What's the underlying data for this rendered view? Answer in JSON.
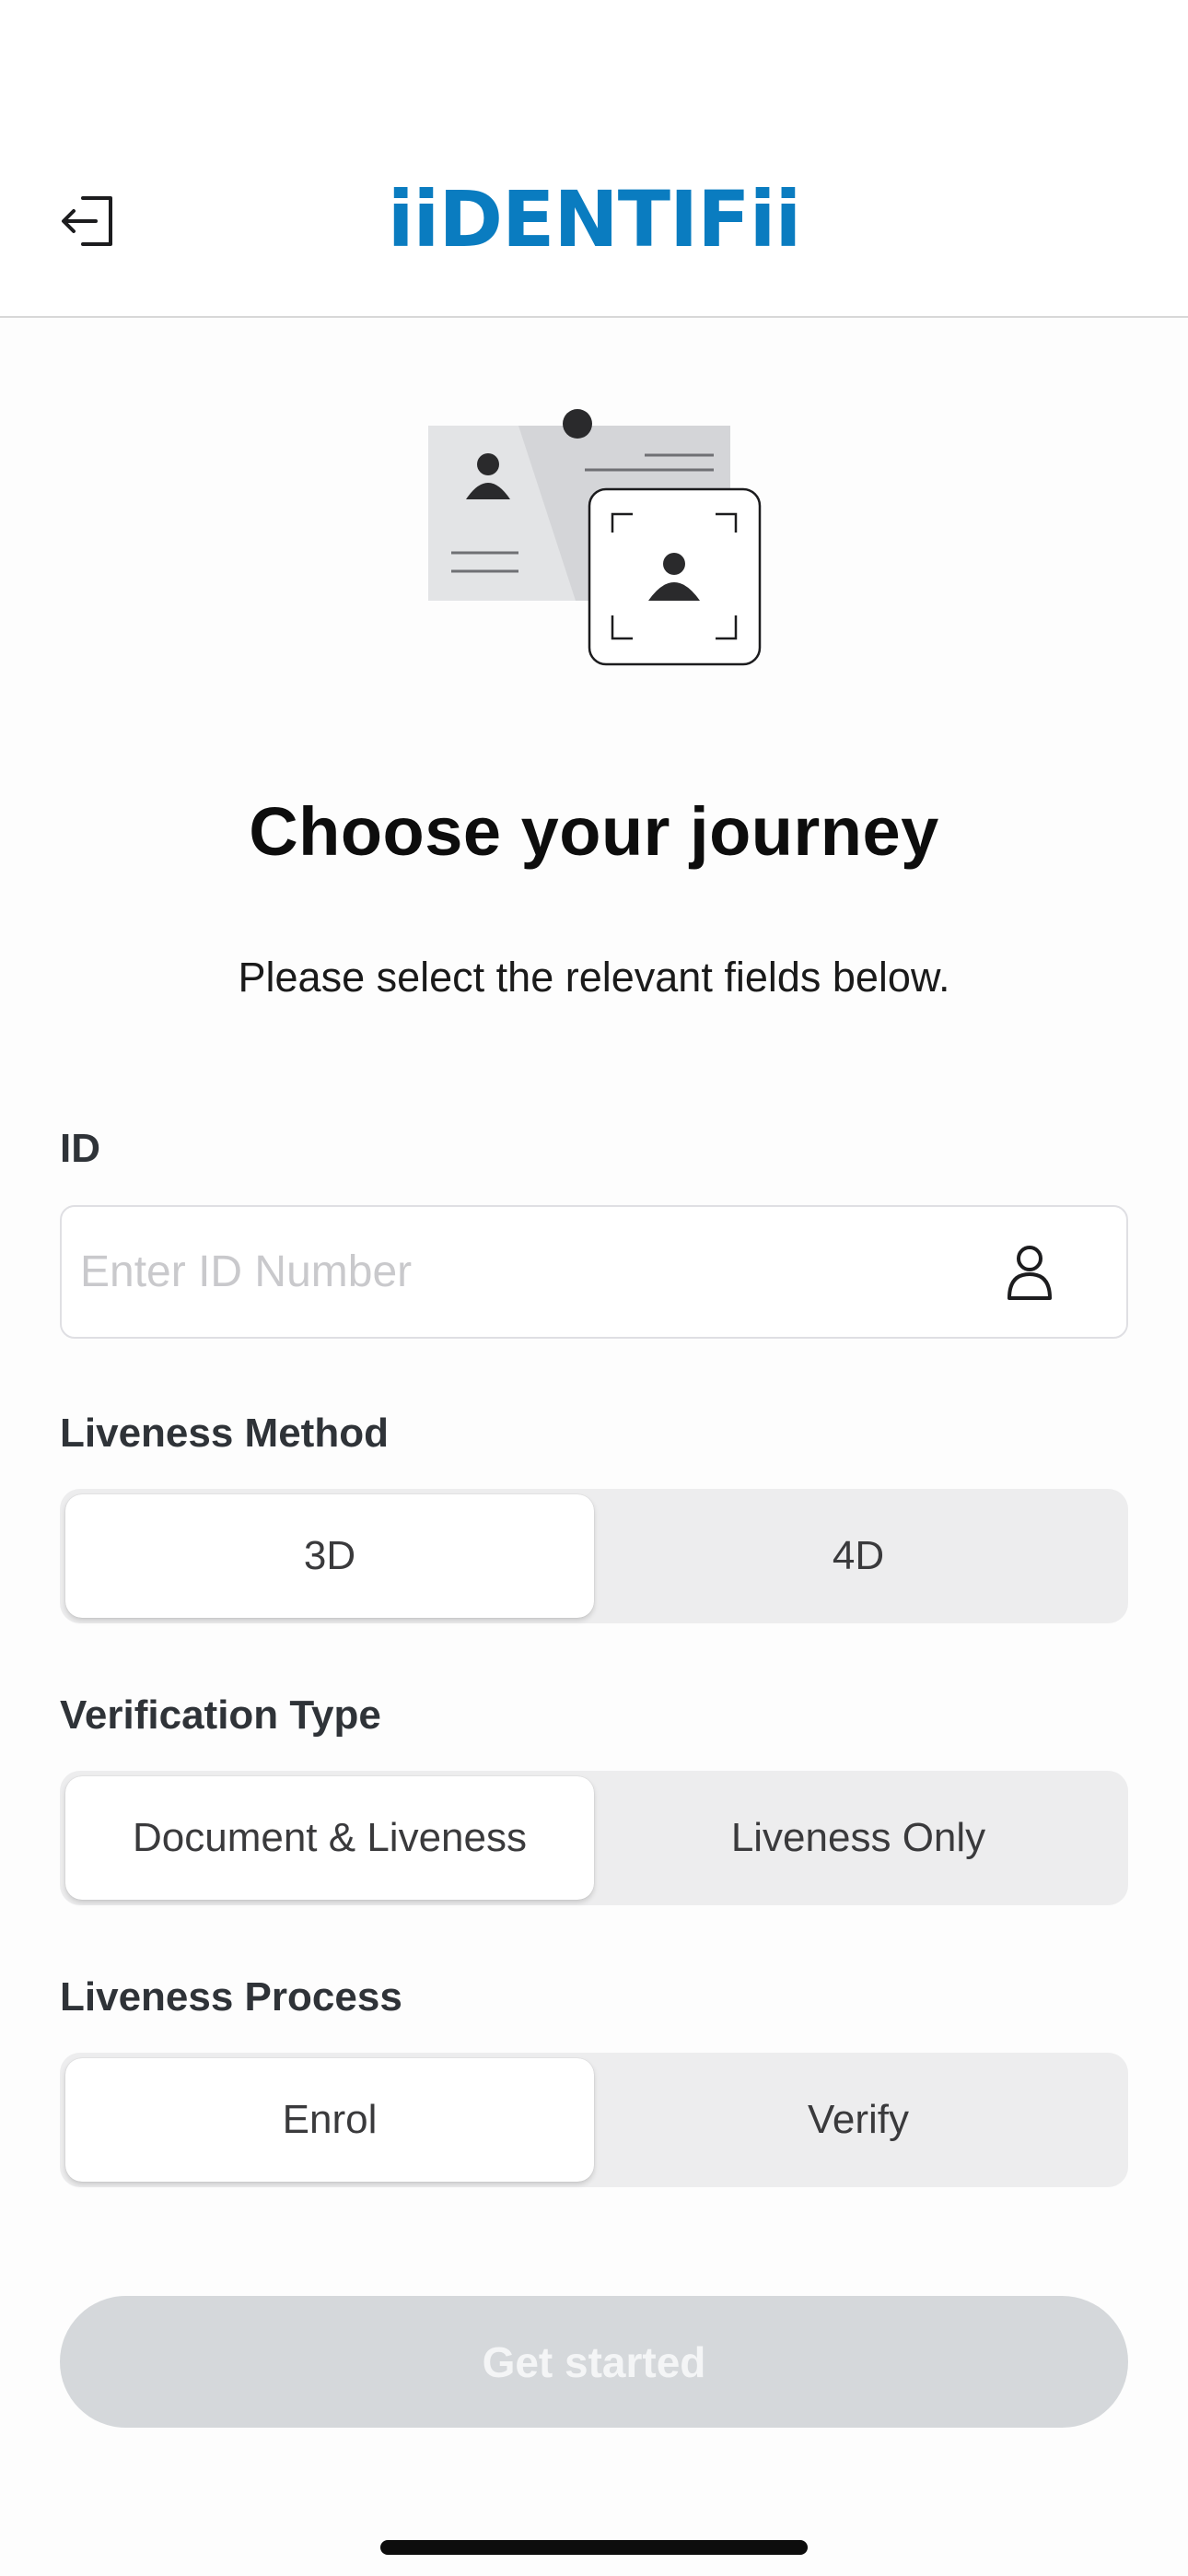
{
  "header": {
    "brand": "iiDENTIFii",
    "exit_icon": "sign-out-icon"
  },
  "main": {
    "title": "Choose your journey",
    "subtitle": "Please select the relevant fields below."
  },
  "id_section": {
    "label": "ID",
    "placeholder": "Enter ID Number",
    "value": "",
    "icon": "person-icon"
  },
  "liveness_method": {
    "label": "Liveness Method",
    "options": [
      "3D",
      "4D"
    ],
    "selected": "3D"
  },
  "verification_type": {
    "label": "Verification Type",
    "options": [
      "Document & Liveness",
      "Liveness Only"
    ],
    "selected": "Document & Liveness"
  },
  "liveness_process": {
    "label": "Liveness Process",
    "options": [
      "Enrol",
      "Verify"
    ],
    "selected": "Enrol"
  },
  "cta": {
    "label": "Get started",
    "enabled": false
  },
  "colors": {
    "brand": "#0a7cc0",
    "cta_disabled": "#d5d8db",
    "segment_bg": "#ededee"
  }
}
